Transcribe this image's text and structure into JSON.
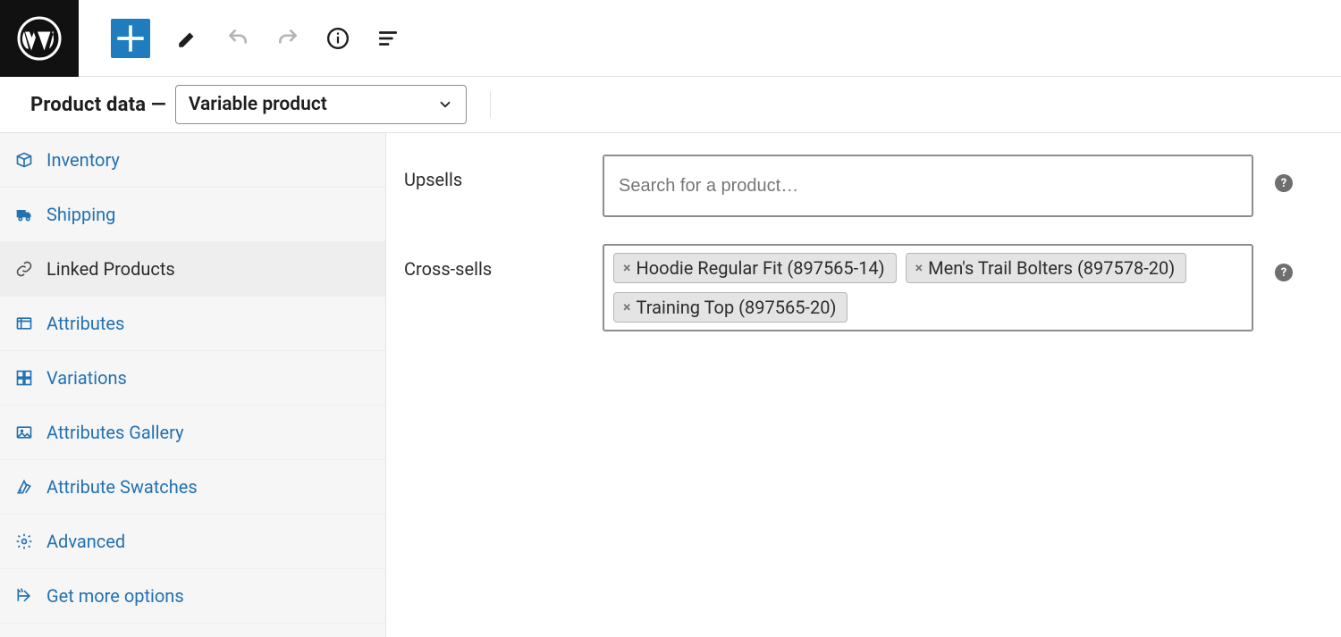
{
  "productBar": {
    "label": "Product data —",
    "selected": "Variable product"
  },
  "sidebar": {
    "items": [
      {
        "label": "Inventory",
        "icon": "inventory",
        "active": false
      },
      {
        "label": "Shipping",
        "icon": "shipping",
        "active": false
      },
      {
        "label": "Linked Products",
        "icon": "link",
        "active": true
      },
      {
        "label": "Attributes",
        "icon": "attributes",
        "active": false
      },
      {
        "label": "Variations",
        "icon": "variations",
        "active": false
      },
      {
        "label": "Attributes Gallery",
        "icon": "gallery",
        "active": false
      },
      {
        "label": "Attribute Swatches",
        "icon": "swatches",
        "active": false
      },
      {
        "label": "Advanced",
        "icon": "advanced",
        "active": false
      },
      {
        "label": "Get more options",
        "icon": "more",
        "active": false
      }
    ]
  },
  "panel": {
    "rows": [
      {
        "key": "upsells",
        "label": "Upsells",
        "placeholder": "Search for a product…",
        "chips": []
      },
      {
        "key": "crosssells",
        "label": "Cross-sells",
        "placeholder": "",
        "chips": [
          "Hoodie Regular Fit (897565-14)",
          "Men's Trail Bolters (897578-20)",
          "Training Top (897565-20)"
        ]
      }
    ]
  }
}
